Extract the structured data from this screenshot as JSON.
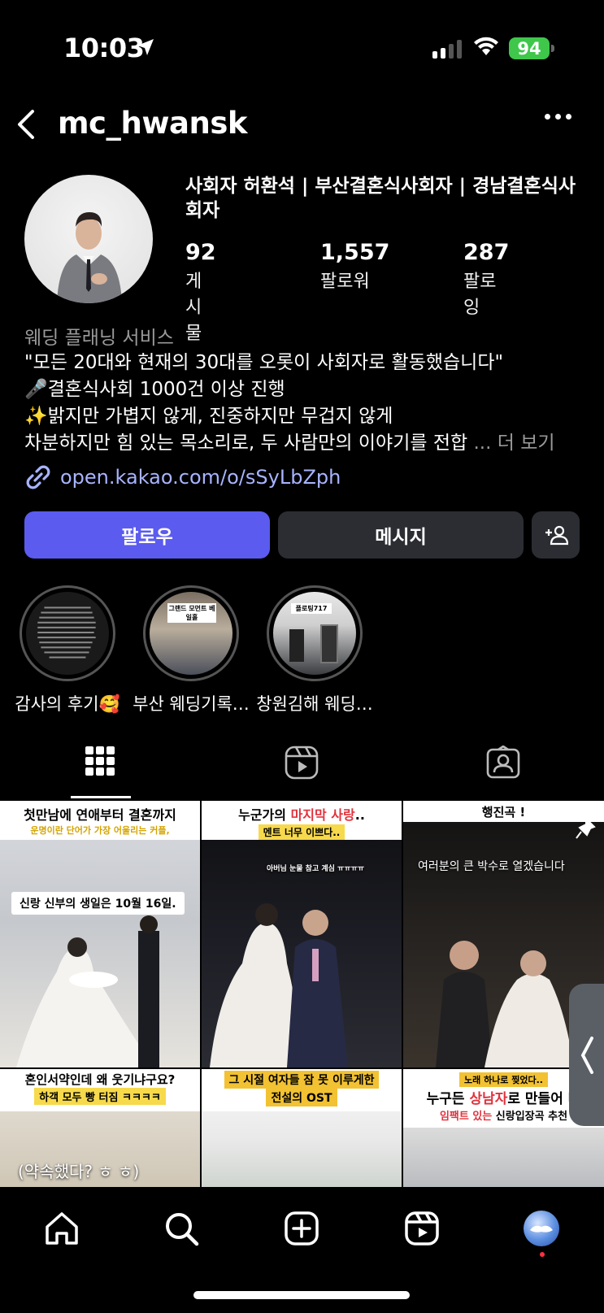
{
  "status_bar": {
    "time": "10:03",
    "battery": "94"
  },
  "header": {
    "username": "mc_hwansk"
  },
  "profile": {
    "display_name": "사회자 허환석 | 부산결혼식사회자 | 경남결혼식사회자",
    "stats": [
      {
        "value": "92",
        "label": "게시물"
      },
      {
        "value": "1,557",
        "label": "팔로워"
      },
      {
        "value": "287",
        "label": "팔로잉"
      }
    ],
    "category": "웨딩 플래닝 서비스",
    "bio_lines": [
      "\"모든 20대와 현재의 30대를 오롯이 사회자로 활동했습니다\"",
      "🎤결혼식사회 1000건 이상 진행",
      "✨밝지만 가볍지 않게, 진중하지만 무겁지 않게",
      "차분하지만 힘 있는 목소리로, 두 사람만의 이야기를 전합"
    ],
    "bio_more": "... 더 보기",
    "link": "open.kakao.com/o/sSyLbZph"
  },
  "buttons": {
    "follow": "팔로우",
    "message": "메시지"
  },
  "highlights": [
    {
      "label": "감사의 후기🥰"
    },
    {
      "label": "부산 웨딩기록…"
    },
    {
      "label": "창원김해 웨딩…"
    }
  ],
  "highlight_thumb_texts": [
    "그랜드 모먼트 베일홀",
    "플로팅717"
  ],
  "posts": [
    {
      "banner": "첫만남에 연애부터 결혼까지",
      "sub": "운명이란 단어가 가장 어울리는 커플,",
      "overlay": "신랑 신부의 생일은 10월 16일."
    },
    {
      "banner_a": "누군가의 ",
      "banner_b": "마지막 사랑",
      "banner_c": "..",
      "sub": "멘트 너무 이쁘다..",
      "overlay": "아버님 눈물 참고 계심 ㅠㅠㅠㅠ"
    },
    {
      "banner": "행진곡 !",
      "overlay": "여러분의 큰 박수로 열겠습니다"
    },
    {
      "banner": "혼인서약인데 왜 웃기냐구요?",
      "sub": "하객 모두 빵 터짐 ㅋㅋㅋㅋ",
      "overlay": "(약속했다? ㅎ ㅎ)"
    },
    {
      "banner": "그 시절 여자들 잠 못 이루게한",
      "sub": "전설의 OST"
    },
    {
      "top": "노래 하나로 찢었다..",
      "banner_a": "누구든 ",
      "banner_b": "상남자",
      "banner_c": "로 만들어 버",
      "sub_a": "임팩트 있는",
      "sub_b": " 신랑입장곡 추천"
    }
  ],
  "colors": {
    "accent": "#5b5bf0",
    "link": "#a8b4ff",
    "battery": "#3ec74b"
  }
}
